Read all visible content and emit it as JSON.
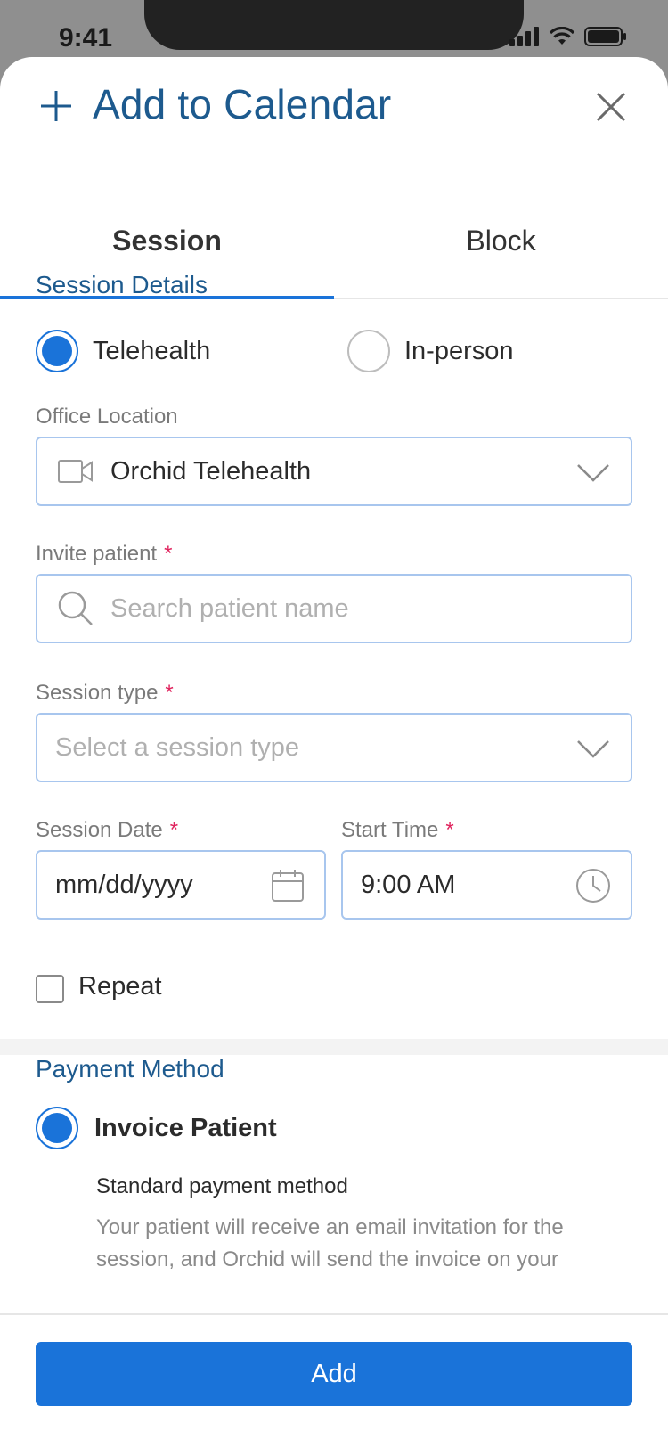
{
  "status_bar": {
    "time": "9:41"
  },
  "header": {
    "title": "Add to Calendar"
  },
  "tabs": [
    {
      "label": "Session",
      "active": true
    },
    {
      "label": "Block",
      "active": false
    }
  ],
  "session_details": {
    "title": "Session Details",
    "mode_options": [
      {
        "label": "Telehealth",
        "selected": true
      },
      {
        "label": "In-person",
        "selected": false
      }
    ],
    "office_location": {
      "label": "Office Location",
      "value": "Orchid Telehealth"
    },
    "invite_patient": {
      "label": "Invite patient",
      "required_mark": "*",
      "placeholder": "Search patient name"
    },
    "session_type": {
      "label": "Session type",
      "required_mark": "*",
      "placeholder": "Select a session type"
    },
    "session_date": {
      "label": "Session Date",
      "required_mark": "*",
      "value": "mm/dd/yyyy"
    },
    "start_time": {
      "label": "Start Time",
      "required_mark": "*",
      "value": "9:00 AM"
    },
    "repeat": {
      "label": "Repeat",
      "checked": false
    }
  },
  "payment": {
    "title": "Payment Method",
    "option": {
      "label": "Invoice Patient",
      "selected": true,
      "subtitle": "Standard payment method",
      "description": "Your patient will receive an email invitation for the session, and Orchid will send the invoice on your"
    }
  },
  "footer": {
    "add_label": "Add"
  },
  "colors": {
    "accent": "#1a73d9",
    "title": "#1d5a8e",
    "required": "#e0245e"
  }
}
